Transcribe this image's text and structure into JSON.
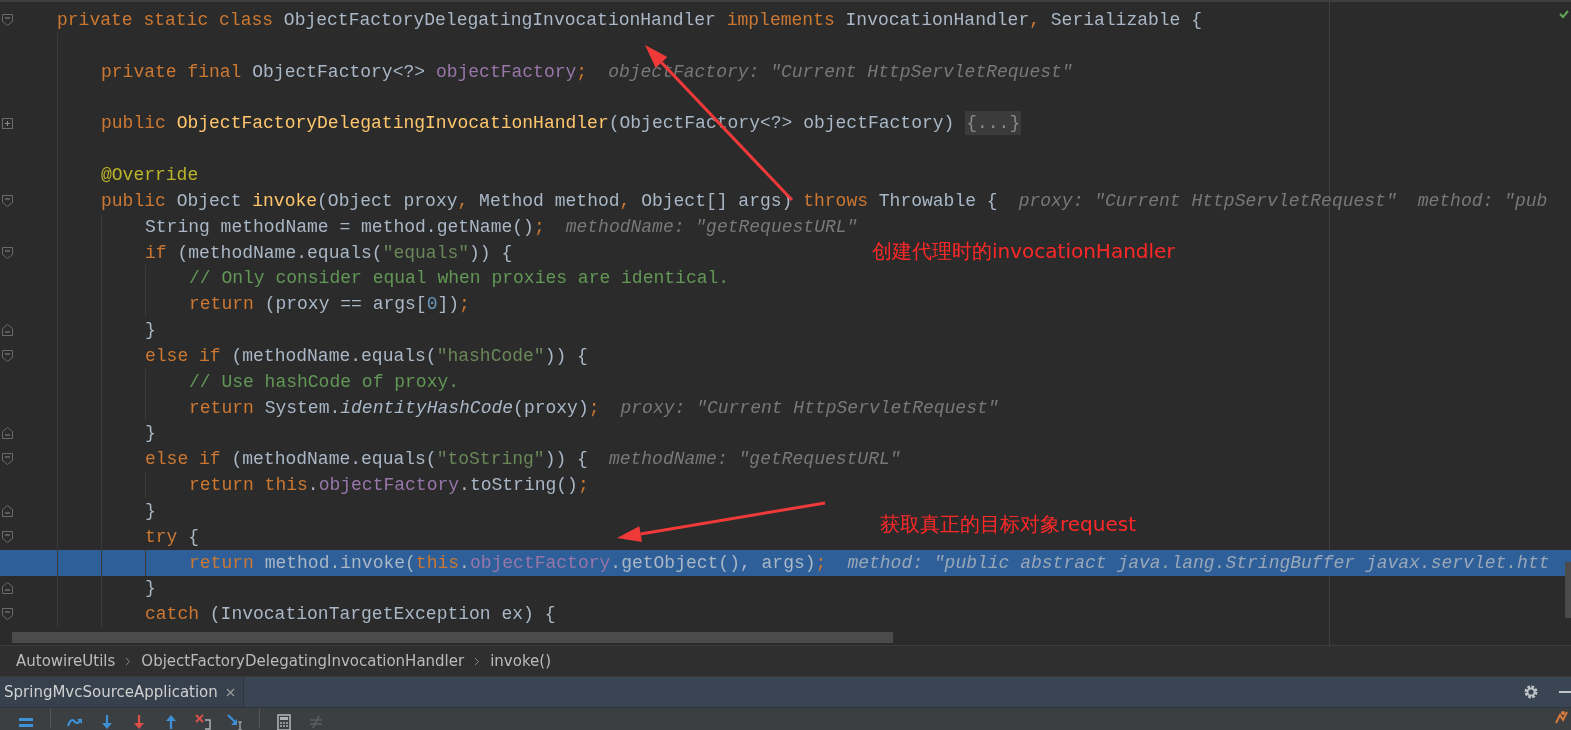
{
  "editor": {
    "lines": [
      {
        "kind": "code",
        "current": false,
        "gutter_icon": {
          "kind": "fold-start"
        },
        "tokens": [
          {
            "kind": "keyword",
            "text": "private static class "
          },
          {
            "kind": "plain",
            "text": "ObjectFactoryDelegatingInvocationHandler "
          },
          {
            "kind": "keyword",
            "text": "implements "
          },
          {
            "kind": "plain",
            "text": "InvocationHandler"
          },
          {
            "kind": "keyword",
            "text": ", "
          },
          {
            "kind": "plain",
            "text": "Serializable {"
          }
        ],
        "children": [
          {
            "kind": "blank"
          },
          {
            "kind": "code",
            "current": false,
            "tokens": [
              {
                "kind": "keyword",
                "text": "private final "
              },
              {
                "kind": "plain",
                "text": "ObjectFactory<?> "
              },
              {
                "kind": "field",
                "text": "objectFactory"
              },
              {
                "kind": "keyword",
                "text": ";"
              },
              {
                "kind": "hint",
                "text": "objectFactory: \"Current HttpServletRequest\""
              }
            ]
          },
          {
            "kind": "blank"
          },
          {
            "kind": "code",
            "current": false,
            "gutter_icon": {
              "kind": "collapsed"
            },
            "tokens": [
              {
                "kind": "keyword",
                "text": "public "
              },
              {
                "kind": "declaration",
                "text": "ObjectFactoryDelegatingInvocationHandler"
              },
              {
                "kind": "plain",
                "text": "(ObjectFactory<?> objectFactory) "
              },
              {
                "kind": "folded",
                "text": "{...}"
              }
            ]
          },
          {
            "kind": "blank"
          },
          {
            "kind": "code",
            "current": false,
            "tokens": [
              {
                "kind": "annotation",
                "text": "@Override"
              }
            ]
          },
          {
            "kind": "code",
            "current": false,
            "gutter_icon": {
              "kind": "fold-start"
            },
            "tokens": [
              {
                "kind": "keyword",
                "text": "public "
              },
              {
                "kind": "plain",
                "text": "Object "
              },
              {
                "kind": "declaration",
                "text": "invoke"
              },
              {
                "kind": "plain",
                "text": "(Object proxy"
              },
              {
                "kind": "keyword",
                "text": ", "
              },
              {
                "kind": "plain",
                "text": "Method method"
              },
              {
                "kind": "keyword",
                "text": ", "
              },
              {
                "kind": "plain",
                "text": "Object[] args) "
              },
              {
                "kind": "keyword",
                "text": "throws "
              },
              {
                "kind": "plain",
                "text": "Throwable {"
              },
              {
                "kind": "hint",
                "text": "proxy: \"Current HttpServletRequest\""
              },
              {
                "kind": "hint",
                "text": "method: \"pub"
              }
            ],
            "children": [
              {
                "kind": "code",
                "current": false,
                "tokens": [
                  {
                    "kind": "plain",
                    "text": "String methodName = method.getName()"
                  },
                  {
                    "kind": "keyword",
                    "text": ";"
                  },
                  {
                    "kind": "hint",
                    "text": "methodName: \"getRequestURL\""
                  }
                ]
              },
              {
                "kind": "code",
                "current": false,
                "gutter_icon": {
                  "kind": "fold-start"
                },
                "tokens": [
                  {
                    "kind": "keyword",
                    "text": "if "
                  },
                  {
                    "kind": "plain",
                    "text": "(methodName.equals("
                  },
                  {
                    "kind": "string",
                    "text": "\"equals\""
                  },
                  {
                    "kind": "plain",
                    "text": ")) {"
                  }
                ],
                "children": [
                  {
                    "kind": "code",
                    "current": false,
                    "tokens": [
                      {
                        "kind": "comment",
                        "text": "// Only consider equal when proxies are identical."
                      }
                    ]
                  },
                  {
                    "kind": "code",
                    "current": false,
                    "tokens": [
                      {
                        "kind": "keyword",
                        "text": "return "
                      },
                      {
                        "kind": "plain",
                        "text": "(proxy == args["
                      },
                      {
                        "kind": "number",
                        "text": "0"
                      },
                      {
                        "kind": "plain",
                        "text": "])"
                      },
                      {
                        "kind": "keyword",
                        "text": ";"
                      }
                    ]
                  }
                ]
              },
              {
                "kind": "code",
                "current": false,
                "gutter_icon": {
                  "kind": "fold-end"
                },
                "tokens": [
                  {
                    "kind": "plain",
                    "text": "}"
                  }
                ]
              },
              {
                "kind": "code",
                "current": false,
                "gutter_icon": {
                  "kind": "fold-start"
                },
                "tokens": [
                  {
                    "kind": "keyword",
                    "text": "else if "
                  },
                  {
                    "kind": "plain",
                    "text": "(methodName.equals("
                  },
                  {
                    "kind": "string",
                    "text": "\"hashCode\""
                  },
                  {
                    "kind": "plain",
                    "text": ")) {"
                  }
                ],
                "children": [
                  {
                    "kind": "code",
                    "current": false,
                    "tokens": [
                      {
                        "kind": "comment",
                        "text": "// Use hashCode of proxy."
                      }
                    ]
                  },
                  {
                    "kind": "code",
                    "current": false,
                    "tokens": [
                      {
                        "kind": "keyword",
                        "text": "return "
                      },
                      {
                        "kind": "plain",
                        "text": "System."
                      },
                      {
                        "kind": "static-call",
                        "text": "identityHashCode"
                      },
                      {
                        "kind": "plain",
                        "text": "(proxy)"
                      },
                      {
                        "kind": "keyword",
                        "text": ";"
                      },
                      {
                        "kind": "hint",
                        "text": "proxy: \"Current HttpServletRequest\""
                      }
                    ]
                  }
                ]
              },
              {
                "kind": "code",
                "current": false,
                "gutter_icon": {
                  "kind": "fold-end"
                },
                "tokens": [
                  {
                    "kind": "plain",
                    "text": "}"
                  }
                ]
              },
              {
                "kind": "code",
                "current": false,
                "gutter_icon": {
                  "kind": "fold-start"
                },
                "tokens": [
                  {
                    "kind": "keyword",
                    "text": "else if "
                  },
                  {
                    "kind": "plain",
                    "text": "(methodName.equals("
                  },
                  {
                    "kind": "string",
                    "text": "\"toString\""
                  },
                  {
                    "kind": "plain",
                    "text": ")) {"
                  },
                  {
                    "kind": "hint",
                    "text": "methodName: \"getRequestURL\""
                  }
                ],
                "children": [
                  {
                    "kind": "code",
                    "current": false,
                    "tokens": [
                      {
                        "kind": "keyword",
                        "text": "return this"
                      },
                      {
                        "kind": "plain",
                        "text": "."
                      },
                      {
                        "kind": "field",
                        "text": "objectFactory"
                      },
                      {
                        "kind": "plain",
                        "text": ".toString()"
                      },
                      {
                        "kind": "keyword",
                        "text": ";"
                      }
                    ]
                  }
                ]
              },
              {
                "kind": "code",
                "current": false,
                "gutter_icon": {
                  "kind": "fold-end"
                },
                "tokens": [
                  {
                    "kind": "plain",
                    "text": "}"
                  }
                ]
              },
              {
                "kind": "code",
                "current": false,
                "gutter_icon": {
                  "kind": "fold-start"
                },
                "tokens": [
                  {
                    "kind": "keyword",
                    "text": "try "
                  },
                  {
                    "kind": "plain",
                    "text": "{"
                  }
                ],
                "children": [
                  {
                    "kind": "code",
                    "current": true,
                    "tokens": [
                      {
                        "kind": "keyword",
                        "text": "return "
                      },
                      {
                        "kind": "plain",
                        "text": "method.invoke("
                      },
                      {
                        "kind": "keyword",
                        "text": "this"
                      },
                      {
                        "kind": "plain",
                        "text": "."
                      },
                      {
                        "kind": "field",
                        "text": "objectFactory"
                      },
                      {
                        "kind": "plain",
                        "text": ".getObject(), args)"
                      },
                      {
                        "kind": "keyword",
                        "text": ";"
                      },
                      {
                        "kind": "hint",
                        "text": "method: \"public abstract java.lang.StringBuffer javax.servlet.htt"
                      }
                    ]
                  }
                ]
              },
              {
                "kind": "code",
                "current": false,
                "gutter_icon": {
                  "kind": "fold-end"
                },
                "tokens": [
                  {
                    "kind": "plain",
                    "text": "}"
                  }
                ]
              },
              {
                "kind": "code",
                "current": false,
                "gutter_icon": {
                  "kind": "fold-start"
                },
                "tokens": [
                  {
                    "kind": "keyword",
                    "text": "catch "
                  },
                  {
                    "kind": "plain",
                    "text": "(InvocationTargetException ex) {"
                  }
                ]
              }
            ]
          }
        ]
      }
    ]
  },
  "breadcrumbs": [
    "AutowireUtils",
    "ObjectFactoryDelegatingInvocationHandler",
    "invoke()"
  ],
  "tool_window": {
    "tabs": [
      {
        "label": "SpringMvcSourceApplication"
      }
    ]
  },
  "debug_toolbar": [
    {
      "kind": "list",
      "disabled": false
    },
    {
      "kind": "separator"
    },
    {
      "kind": "step-over",
      "disabled": false
    },
    {
      "kind": "step-into",
      "disabled": false
    },
    {
      "kind": "force-step-into",
      "disabled": false
    },
    {
      "kind": "step-out",
      "disabled": false
    },
    {
      "kind": "drop-frame",
      "disabled": false
    },
    {
      "kind": "run-to-cursor",
      "disabled": false
    },
    {
      "kind": "separator"
    },
    {
      "kind": "evaluate",
      "disabled": false
    },
    {
      "kind": "trace",
      "disabled": true
    }
  ],
  "annotations": [
    {
      "text": "创建代理时的invocationHandler"
    },
    {
      "text": "获取真正的目标对象request"
    }
  ]
}
